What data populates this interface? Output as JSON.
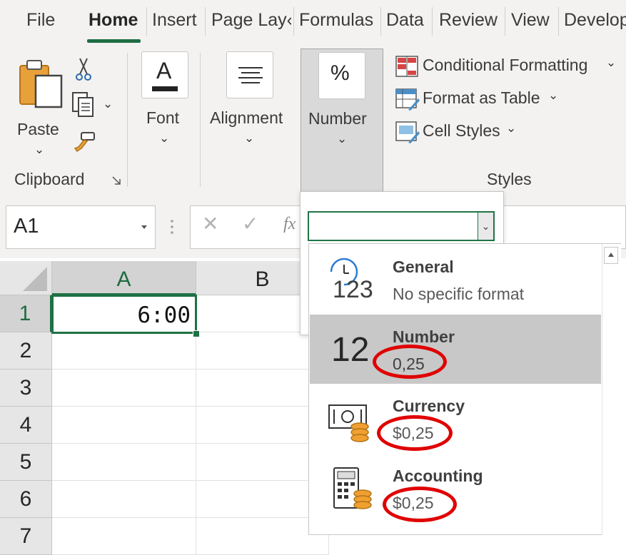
{
  "tabs": [
    {
      "label": "File",
      "active": false
    },
    {
      "label": "Home",
      "active": true
    },
    {
      "label": "Insert",
      "active": false
    },
    {
      "label": "Page Lay‹",
      "active": false
    },
    {
      "label": "Formulas",
      "active": false
    },
    {
      "label": "Data",
      "active": false
    },
    {
      "label": "Review",
      "active": false
    },
    {
      "label": "View",
      "active": false
    },
    {
      "label": "Develop",
      "active": false
    }
  ],
  "ribbon": {
    "paste_label": "Paste",
    "clipboard_group": "Clipboard",
    "font_label": "Font",
    "font_icon_letter": "A",
    "alignment_label": "Alignment",
    "number_label": "Number",
    "number_icon": "%",
    "conditional_formatting": "Conditional Formatting",
    "format_as_table": "Format as Table",
    "cell_styles": "Cell Styles",
    "styles_group": "Styles"
  },
  "formula_bar": {
    "name_box": "A1",
    "fx": "fx",
    "number_format_value": ""
  },
  "grid": {
    "columns": [
      "A",
      "B"
    ],
    "rows": [
      "1",
      "2",
      "3",
      "4",
      "5",
      "6",
      "7"
    ],
    "selected_cell": "A1",
    "a1_value": "6:00"
  },
  "number_format_menu": {
    "options": [
      {
        "title": "General",
        "sample": "No specific format",
        "icon_text": "123",
        "icon": "clock-123-icon"
      },
      {
        "title": "Number",
        "sample": "0,25",
        "icon_text": "12",
        "icon": "number-12-icon",
        "selected": true,
        "circled": true
      },
      {
        "title": "Currency",
        "sample": "$0,25",
        "icon": "currency-bill-coins-icon",
        "circled": true
      },
      {
        "title": "Accounting",
        "sample": "$0,25",
        "icon": "calculator-coins-icon",
        "circled": true
      }
    ]
  },
  "colors": {
    "accent_green": "#217346",
    "annotation_red": "#e00000",
    "ribbon_bg": "#f3f2f1"
  }
}
